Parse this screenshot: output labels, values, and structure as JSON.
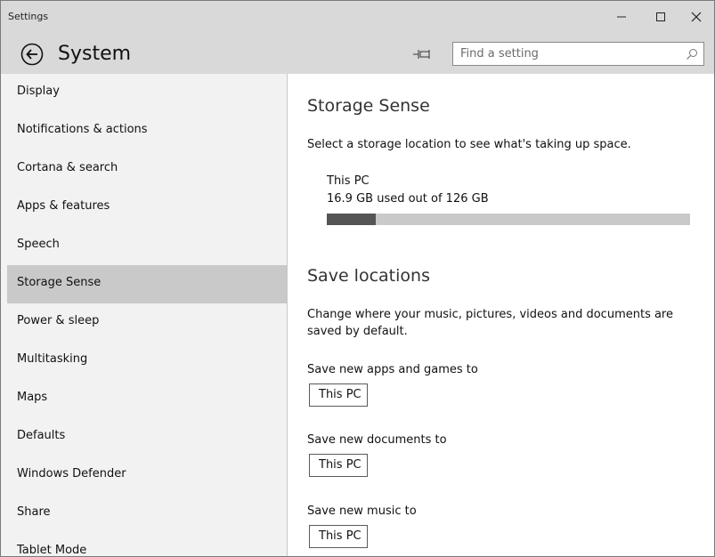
{
  "window": {
    "title": "Settings"
  },
  "header": {
    "title": "System"
  },
  "search": {
    "placeholder": "Find a setting"
  },
  "sidebar": {
    "items": [
      {
        "label": "Display"
      },
      {
        "label": "Notifications & actions"
      },
      {
        "label": "Cortana & search"
      },
      {
        "label": "Apps & features"
      },
      {
        "label": "Speech"
      },
      {
        "label": "Storage Sense",
        "selected": true
      },
      {
        "label": "Power & sleep"
      },
      {
        "label": "Multitasking"
      },
      {
        "label": "Maps"
      },
      {
        "label": "Defaults"
      },
      {
        "label": "Windows Defender"
      },
      {
        "label": "Share"
      },
      {
        "label": "Tablet Mode"
      }
    ]
  },
  "storage": {
    "title": "Storage Sense",
    "subtitle": "Select a storage location to see what's taking up space.",
    "drive_name": "This PC",
    "usage_text": "16.9 GB used out of 126 GB",
    "used_fraction": 0.134
  },
  "save_locations": {
    "title": "Save locations",
    "description_line1": "Change where your music, pictures, videos and documents are",
    "description_line2": "saved by default.",
    "apps_label": "Save new apps and games to",
    "apps_value": "This PC",
    "documents_label": "Save new documents to",
    "documents_value": "This PC",
    "music_label": "Save new music to",
    "music_value": "This PC"
  },
  "colors": {
    "titlebar": "#d9d9d9",
    "sidebar_bg": "#f2f2f2",
    "selected_bg": "#c9c9c9",
    "bar_used": "#555555",
    "bar_track": "#c9c9c9"
  }
}
